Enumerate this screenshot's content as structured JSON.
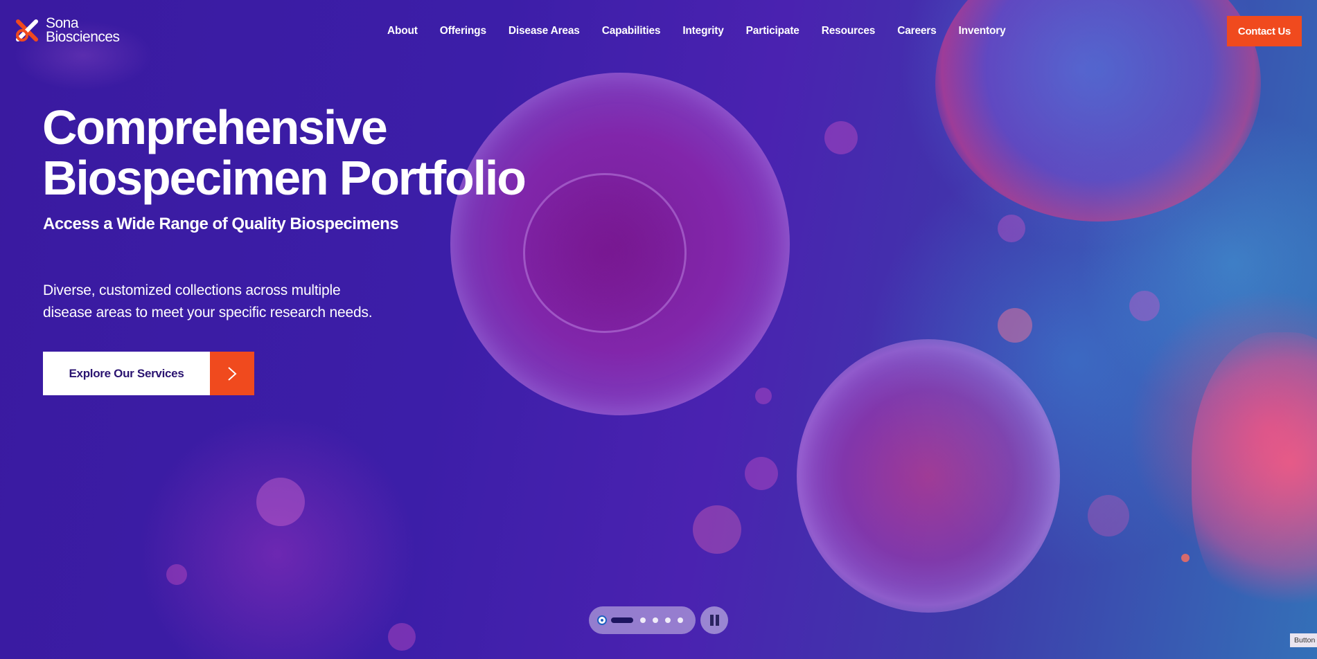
{
  "brand": {
    "name_line1": "Sona",
    "name_line2": "Biosciences",
    "logo_icon": "sona-x-logo-icon",
    "accent_color": "#f04a1e"
  },
  "nav": {
    "items": [
      {
        "label": "About"
      },
      {
        "label": "Offerings"
      },
      {
        "label": "Disease Areas"
      },
      {
        "label": "Capabilities"
      },
      {
        "label": "Integrity"
      },
      {
        "label": "Participate"
      },
      {
        "label": "Resources"
      },
      {
        "label": "Careers"
      },
      {
        "label": "Inventory"
      }
    ],
    "contact_label": "Contact Us"
  },
  "hero": {
    "title_line1": "Comprehensive",
    "title_line2": "Biospecimen Portfolio",
    "subtitle": "Access a Wide Range of Quality Biospecimens",
    "description_line1": "Diverse, customized collections across multiple",
    "description_line2": "disease areas to meet your specific research needs.",
    "cta_label": "Explore Our Services",
    "cta_icon": "chevron-right-icon"
  },
  "slider": {
    "total_slides": 5,
    "active_slide": 1,
    "pause_icon": "pause-icon"
  },
  "corner_tag": {
    "label": "Button"
  }
}
